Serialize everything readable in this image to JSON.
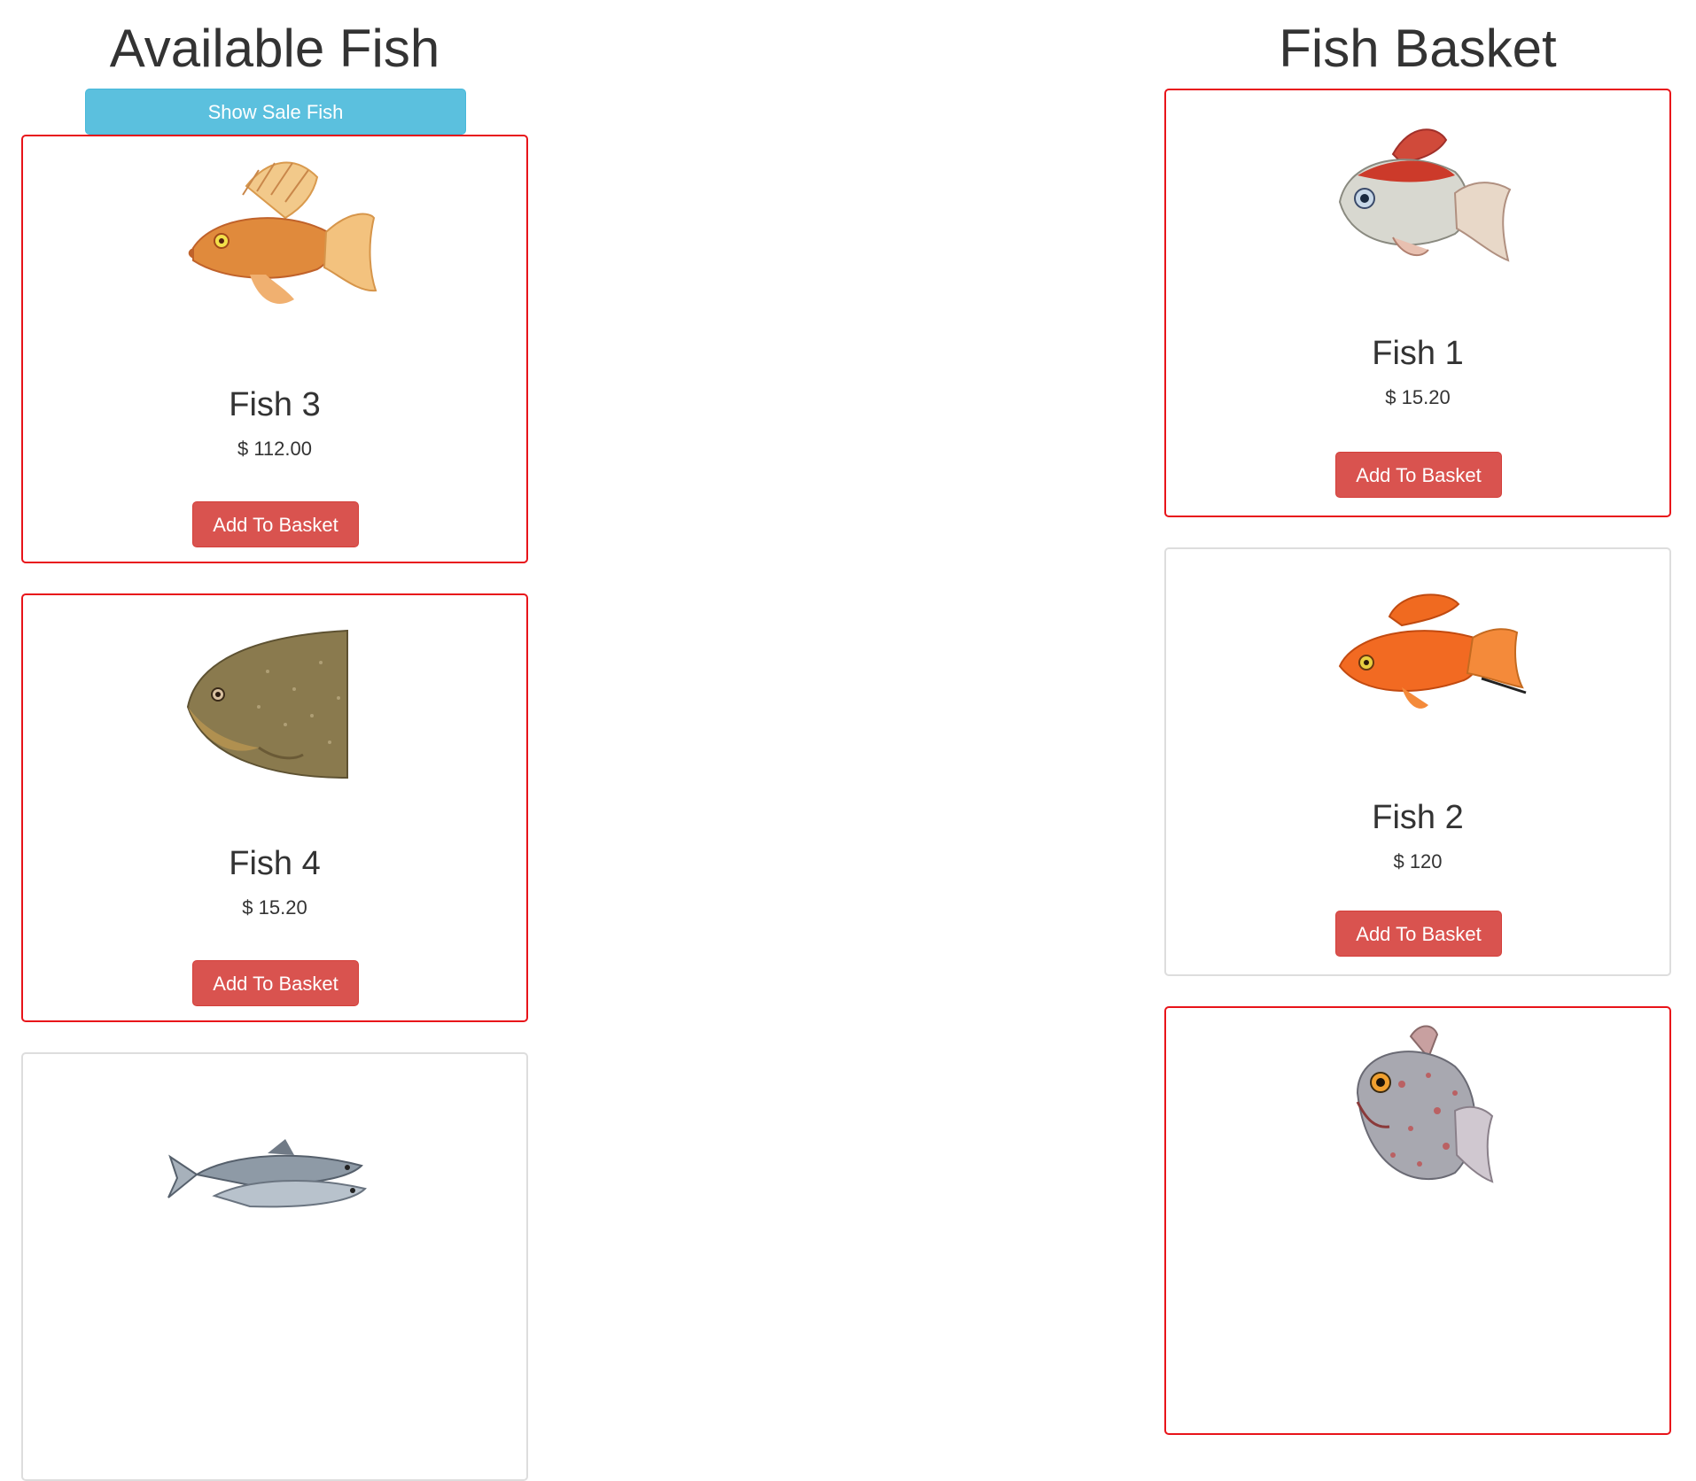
{
  "available": {
    "title": "Available Fish",
    "sale_button": "Show Sale Fish",
    "cards": [
      {
        "name": "Fish 3",
        "price": "$ 112.00",
        "button": "Add To Basket",
        "highlighted": true
      },
      {
        "name": "Fish 4",
        "price": "$ 15.20",
        "button": "Add To Basket",
        "highlighted": true
      },
      {
        "highlighted": false
      }
    ]
  },
  "basket": {
    "title": "Fish Basket",
    "cards": [
      {
        "name": "Fish 1",
        "price": "$ 15.20",
        "button": "Add To Basket",
        "highlighted": true
      },
      {
        "name": "Fish 2",
        "price": "$ 120",
        "button": "Add To Basket",
        "highlighted": false
      },
      {
        "highlighted": true
      }
    ]
  },
  "colors": {
    "highlight_border": "#e8141a",
    "plain_border": "#dddddd",
    "info_button": "#5bc0de",
    "danger_button": "#d9534f"
  },
  "icons": {
    "fish_3": "orange-molly-fish-icon",
    "fish_4": "piranha-fish-icon",
    "fish_5": "catfish-group-icon",
    "fish_1": "red-white-goldfish-icon",
    "fish_2": "orange-swordtail-fish-icon",
    "fish_6": "spotted-piranha-fish-icon"
  }
}
